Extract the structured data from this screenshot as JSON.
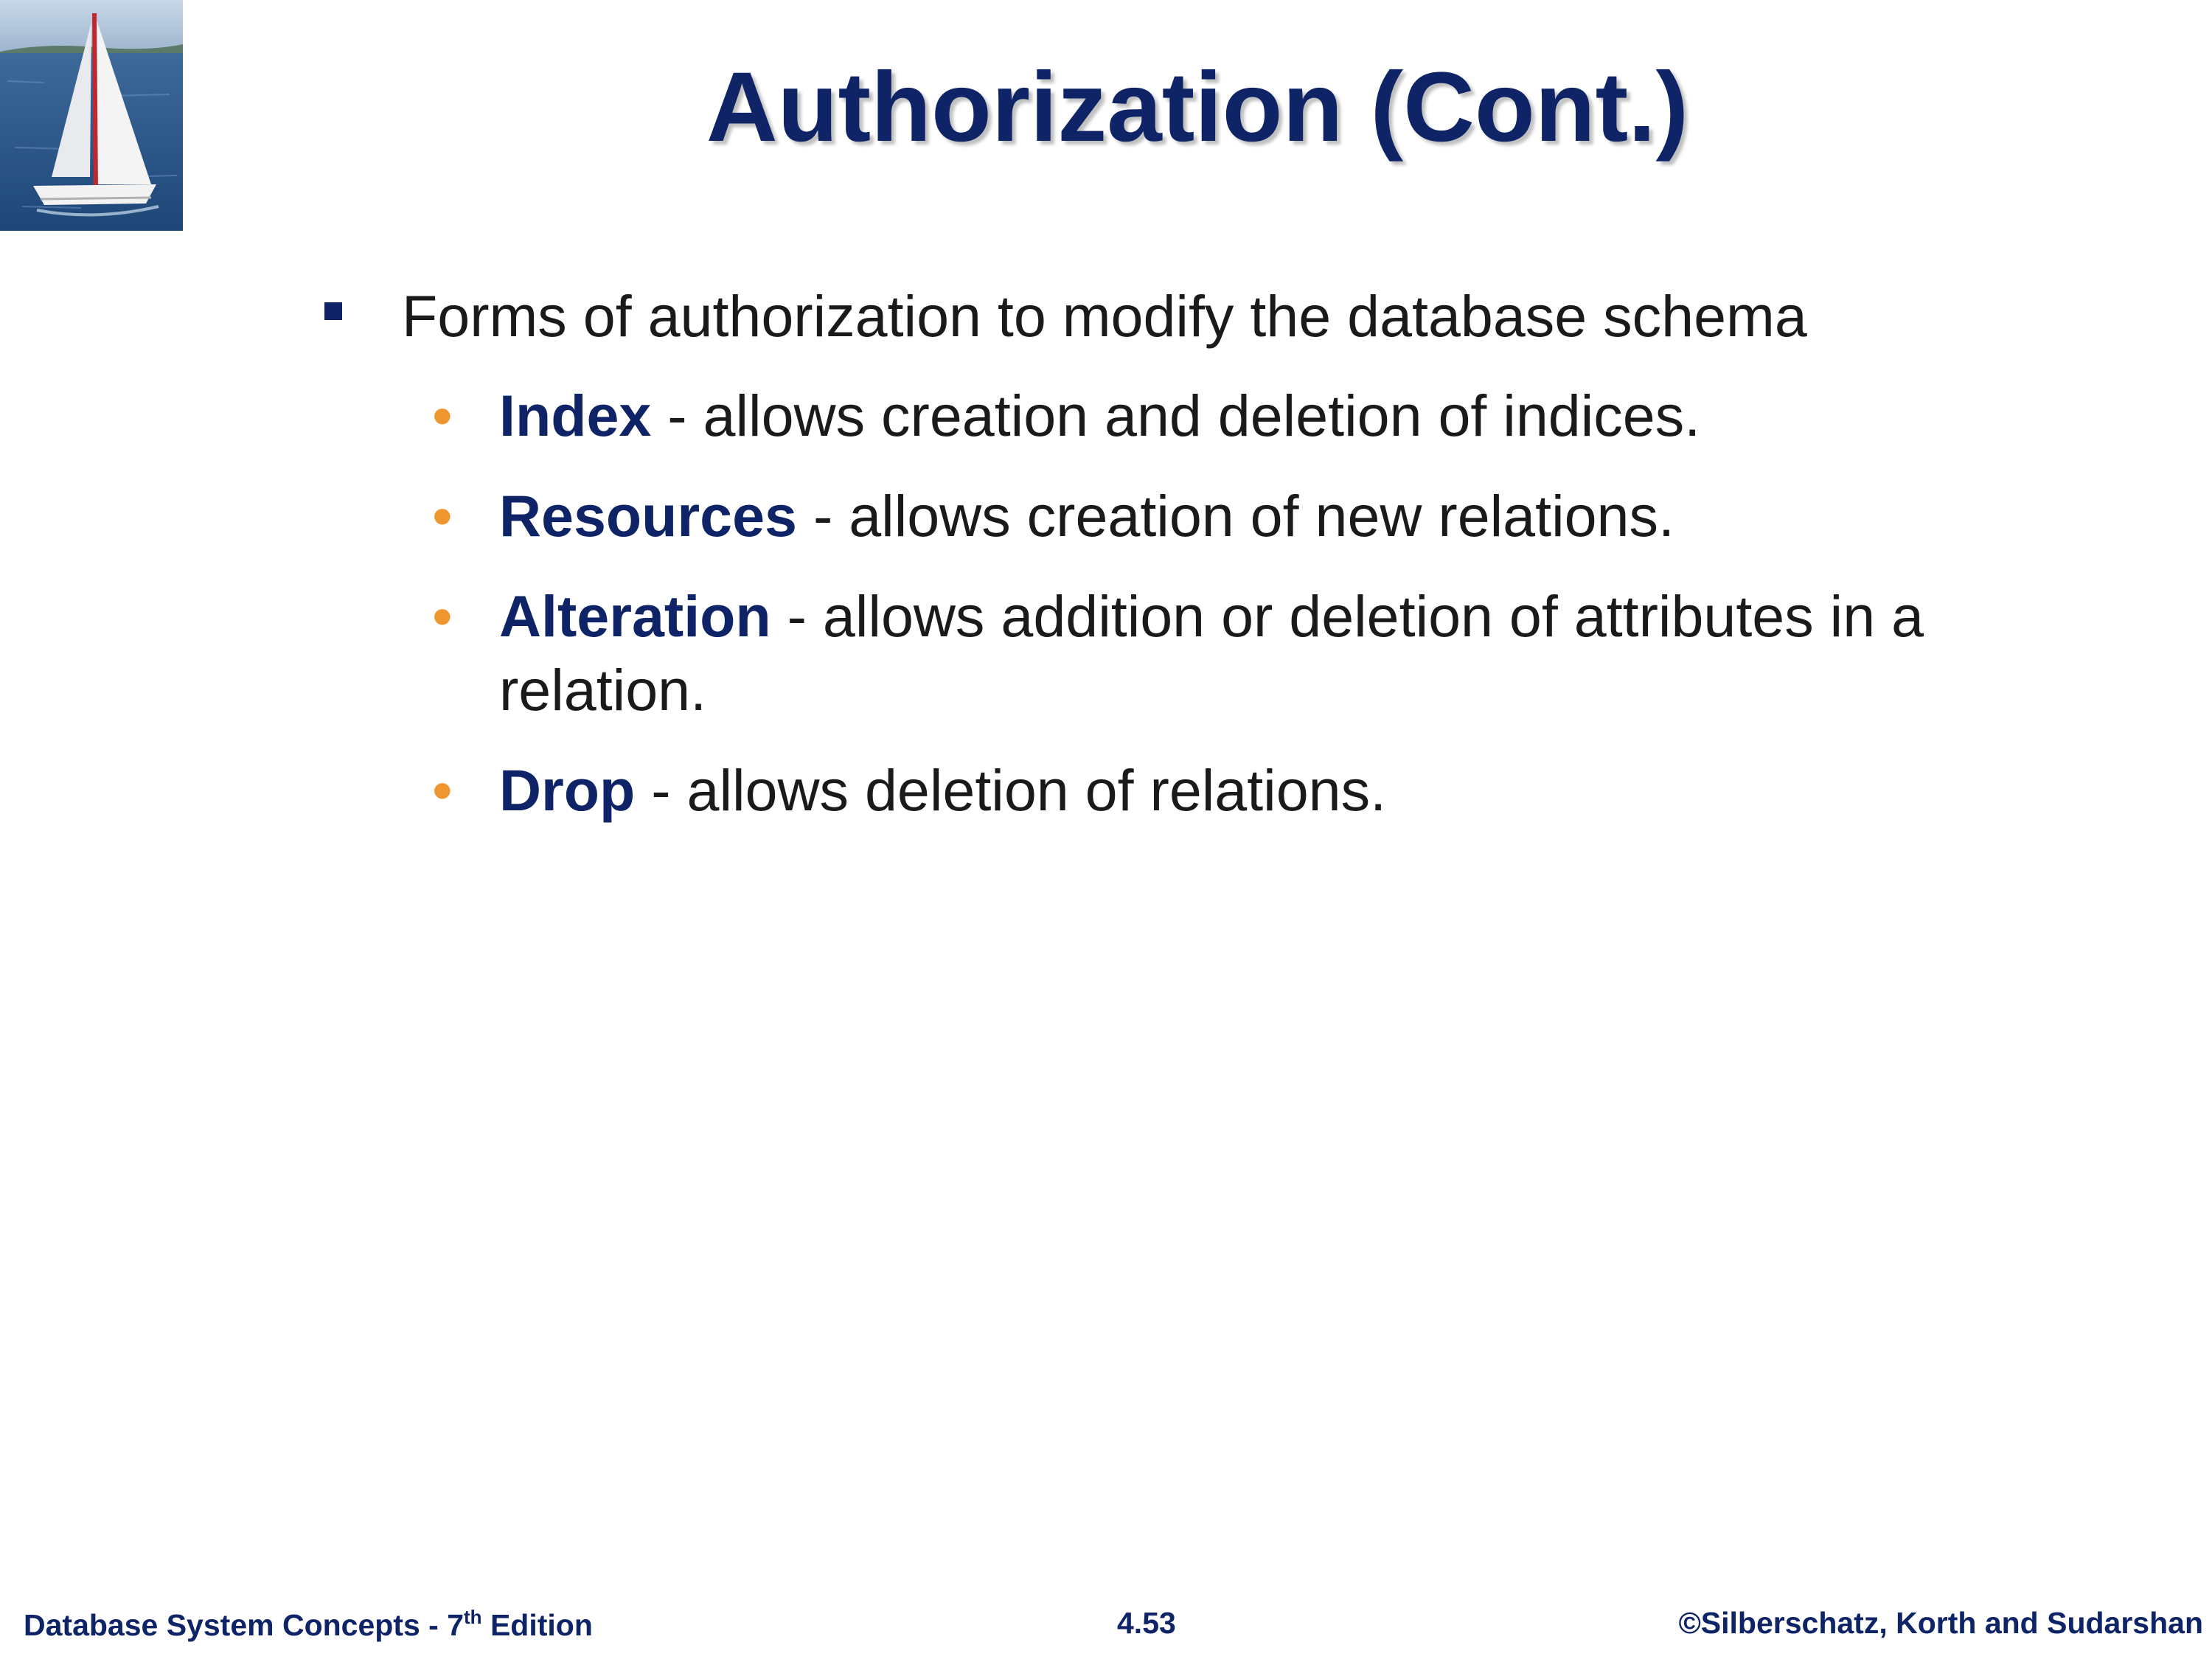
{
  "slide": {
    "title": "Authorization (Cont.)",
    "logo_icon": "sailboat-photo"
  },
  "content": {
    "main_bullet": "Forms of authorization to modify the database schema",
    "items": [
      {
        "term": "Index",
        "description": " - allows creation and deletion of indices."
      },
      {
        "term": "Resources",
        "description": " - allows creation of new relations."
      },
      {
        "term": "Alteration",
        "description": " - allows addition or deletion of attributes in a relation."
      },
      {
        "term": "Drop",
        "description": " - allows deletion of relations."
      }
    ]
  },
  "footer": {
    "book_prefix": "Database System Concepts - 7",
    "book_sup": "th",
    "book_suffix": " Edition",
    "page_number": "4.53",
    "copyright": "©Silberschatz, Korth and Sudarshan"
  },
  "colors": {
    "title": "#0f2466",
    "term": "#0f2466",
    "sub_bullet": "#f0962e",
    "text": "#1a1a1a"
  }
}
